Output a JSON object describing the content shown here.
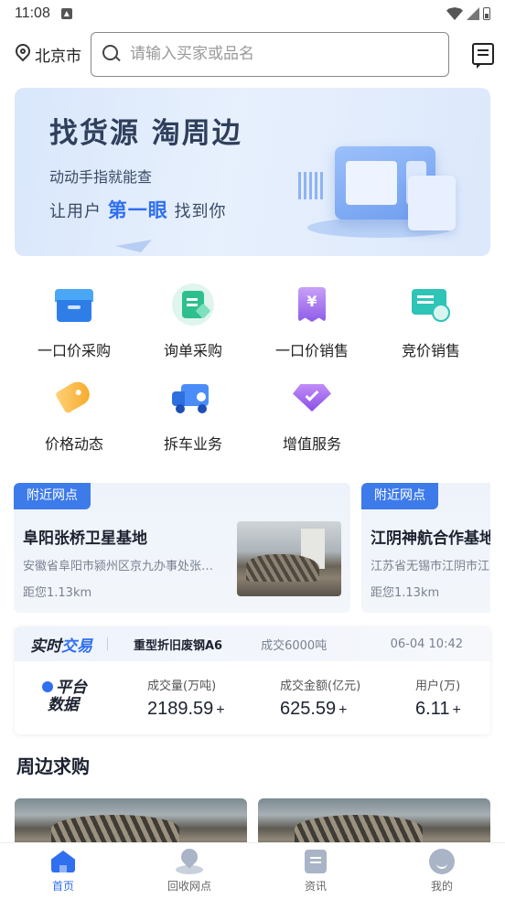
{
  "status_bar": {
    "time": "11:08"
  },
  "header": {
    "city": "北京市",
    "search_placeholder": "请输入买家或品名"
  },
  "banner": {
    "title": "找货源  淘周边",
    "subtitle": "动动手指就能查",
    "tagline_prefix": "让用户",
    "tagline_highlight": "第一眼",
    "tagline_suffix": "找到你"
  },
  "functions": [
    {
      "label": "一口价采购",
      "icon": "store-icon"
    },
    {
      "label": "询单采购",
      "icon": "inquiry-icon"
    },
    {
      "label": "一口价销售",
      "icon": "price-ticket-icon"
    },
    {
      "label": "竞价销售",
      "icon": "bidding-icon"
    },
    {
      "label": "价格动态",
      "icon": "price-tag-icon"
    },
    {
      "label": "拆车业务",
      "icon": "truck-icon"
    },
    {
      "label": "增值服务",
      "icon": "gem-icon"
    }
  ],
  "nearby": [
    {
      "badge": "附近网点",
      "name": "阜阳张桥卫星基地",
      "address": "安徽省阜阳市颍州区京九办事处张桥卫星基地",
      "distance": "距您1.13km"
    },
    {
      "badge": "附近网点",
      "name": "江阴神航合作基地",
      "address": "江苏省无锡市江阴市江阴神航合作基地",
      "distance": "距您1.13km"
    }
  ],
  "trade": {
    "title_black": "实时",
    "title_blue": "交易",
    "item": "重型折旧废钢A6",
    "volume": "成交6000吨",
    "time": "06-04 10:42",
    "platform_line1": "平台",
    "platform_line2": "数据",
    "stats": [
      {
        "label": "成交量(万吨)",
        "value": "2189.59",
        "suffix": "+"
      },
      {
        "label": "成交金额(亿元)",
        "value": "625.59",
        "suffix": "+"
      },
      {
        "label": "用户(万)",
        "value": "6.11",
        "suffix": "+"
      }
    ]
  },
  "section": {
    "title": "周边求购"
  },
  "tabbar": [
    {
      "label": "首页",
      "icon": "home-icon",
      "active": true
    },
    {
      "label": "回收网点",
      "icon": "location-icon",
      "active": false
    },
    {
      "label": "资讯",
      "icon": "news-icon",
      "active": false
    },
    {
      "label": "我的",
      "icon": "profile-icon",
      "active": false
    }
  ],
  "colors": {
    "accent": "#2f6ff0",
    "badge": "#3e7bea"
  }
}
